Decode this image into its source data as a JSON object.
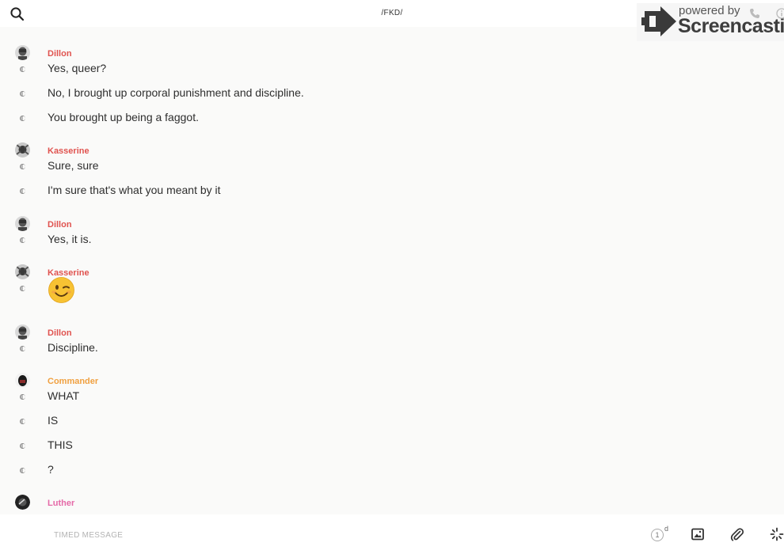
{
  "header": {
    "room_title": "/FKD/"
  },
  "watermark": {
    "powered": "powered by",
    "brand": "Screencastify"
  },
  "messages": [
    {
      "author": "Dillon",
      "author_color": "#e0534f",
      "avatar": "dillon",
      "lines": [
        "Yes, queer?",
        "No, I brought up corporal punishment and discipline.",
        "You brought up being a faggot."
      ]
    },
    {
      "author": "Kasserine",
      "author_color": "#e0534f",
      "avatar": "kasserine",
      "lines": [
        "Sure, sure",
        "I'm sure that's what you meant by it"
      ]
    },
    {
      "author": "Dillon",
      "author_color": "#e0534f",
      "avatar": "dillon",
      "lines": [
        "Yes, it is."
      ]
    },
    {
      "author": "Kasserine",
      "author_color": "#e0534f",
      "avatar": "kasserine",
      "lines": [
        "😉"
      ]
    },
    {
      "author": "Dillon",
      "author_color": "#e0534f",
      "avatar": "dillon",
      "lines": [
        "Discipline."
      ]
    },
    {
      "author": "Commander",
      "author_color": "#f0a040",
      "avatar": "commander",
      "lines": [
        "WHAT",
        "IS",
        "THIS",
        "?"
      ]
    },
    {
      "author": "Luther",
      "author_color": "#e56aa8",
      "avatar": "luther",
      "lines": []
    }
  ],
  "composer": {
    "placeholder": "TIMED MESSAGE",
    "timer_value": "1",
    "timer_unit": "d"
  },
  "icons": {
    "search": "search-icon",
    "phone": "phone-icon",
    "info": "info-icon",
    "image": "image-icon",
    "attach": "paperclip-icon",
    "sparkle": "sparkle-icon"
  }
}
